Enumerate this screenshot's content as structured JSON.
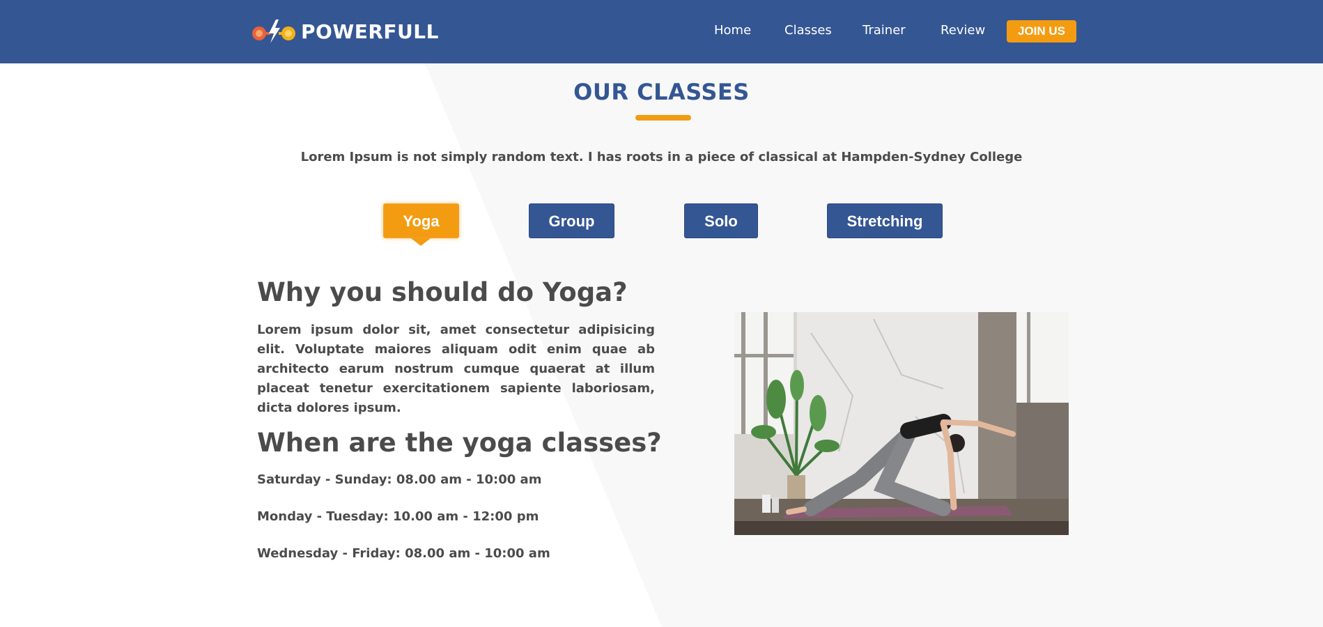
{
  "brand": {
    "name": "POWERFULL",
    "logo_icon": "dumbbell-bolt-icon"
  },
  "nav": {
    "items": [
      "Home",
      "Classes",
      "Trainer",
      "Review"
    ],
    "cta": "JOIN US"
  },
  "classes": {
    "title": "OUR CLASSES",
    "intro": "Lorem Ipsum is not simply random text. I has roots in a piece of classical at Hampden-Sydney College",
    "tabs": [
      "Yoga",
      "Group",
      "Solo",
      "Stretching"
    ],
    "active_tab": "Yoga"
  },
  "detail": {
    "heading": "Why you should do Yoga?",
    "description": "Lorem ipsum dolor sit, amet consectetur adipisicing elit. Voluptate maiores aliquam odit enim quae ab architecto earum nostrum cumque quaerat at illum placeat tenetur exercitationem sapiente laboriosam, dicta dolores ipsum.",
    "schedule_heading": "When are the yoga classes?",
    "schedule": [
      "Saturday - Sunday: 08.00 am - 10:00 am",
      "Monday - Tuesday: 10.00 am - 12:00 pm",
      "Wednesday - Friday: 08.00 am - 10:00 am"
    ],
    "image": "yoga-pose-photo"
  },
  "colors": {
    "primary": "#345693",
    "accent": "#f39c12",
    "text": "#4b4b4b",
    "background_shape": "#f8f8f8"
  }
}
